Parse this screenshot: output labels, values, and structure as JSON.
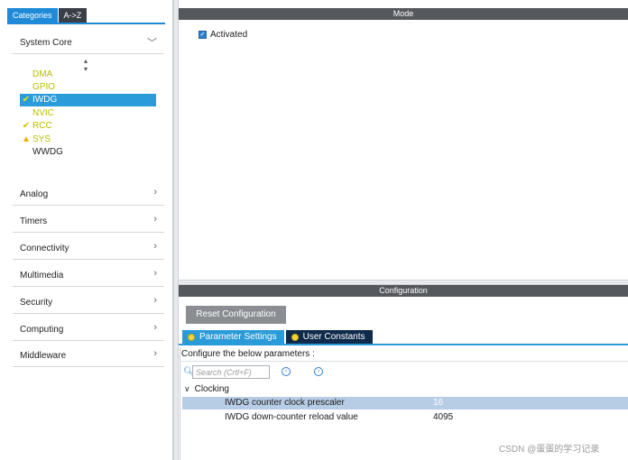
{
  "categories": {
    "tab_categories": "Categories",
    "tab_az": "A->Z"
  },
  "system_core": {
    "label": "System Core",
    "peripherals": [
      {
        "name": "DMA",
        "status": "none",
        "color": "yellow"
      },
      {
        "name": "GPIO",
        "status": "none",
        "color": "yellow"
      },
      {
        "name": "IWDG",
        "status": "ok",
        "color": "yellow",
        "selected": true
      },
      {
        "name": "NVIC",
        "status": "none",
        "color": "yellow"
      },
      {
        "name": "RCC",
        "status": "ok",
        "color": "yellow"
      },
      {
        "name": "SYS",
        "status": "warning",
        "color": "yellow"
      },
      {
        "name": "WWDG",
        "status": "none",
        "color": "black"
      }
    ]
  },
  "groups": [
    "Analog",
    "Timers",
    "Connectivity",
    "Multimedia",
    "Security",
    "Computing",
    "Middleware"
  ],
  "mode": {
    "title": "Mode",
    "activated_label": "Activated",
    "activated_checked": true
  },
  "configuration": {
    "title": "Configuration",
    "reset_label": "Reset Configuration",
    "tabs": [
      "Parameter Settings",
      "User Constants"
    ],
    "configure_label": "Configure the below parameters :",
    "search_placeholder": "Search (Crtl+F)",
    "group_label": "Clocking",
    "params": [
      {
        "name": "IWDG counter clock prescaler",
        "value": "16",
        "selected": true
      },
      {
        "name": "IWDG down-counter reload value",
        "value": "4095",
        "selected": false
      }
    ]
  },
  "watermark": "CSDN @蛋蛋的学习记录",
  "colors": {
    "accent": "#2a9bd8",
    "header_bar": "#55585d",
    "peripheral_text": "#b9bc00",
    "selected_row": "#b7cde6"
  }
}
